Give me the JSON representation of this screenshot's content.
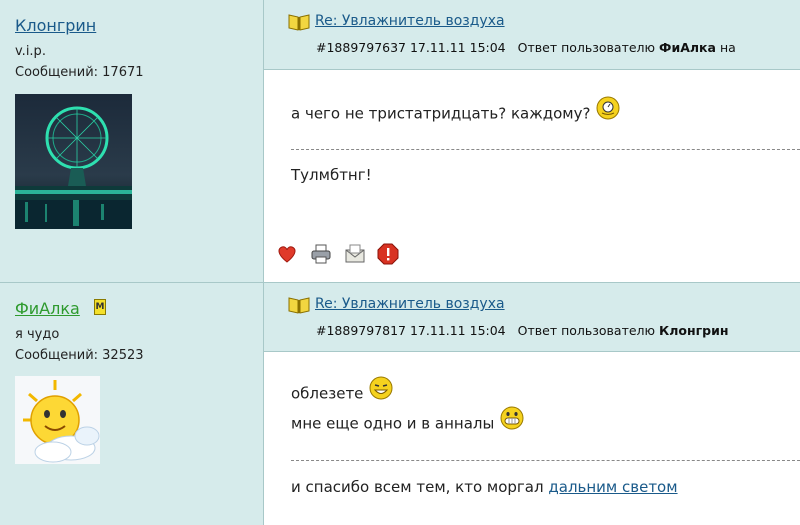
{
  "posts": [
    {
      "author": {
        "name": "Клонгрин",
        "status": "v.i.p.",
        "messages": "Сообщений: 17671",
        "avatar_icon": "ferris-wheel-night-photo"
      },
      "title": "Re: Увлажнитель воздуха",
      "meta": {
        "id_date": "#1889797637 17.11.11 15:04",
        "reply_to_prefix": "Ответ пользователю",
        "reply_to_user": "ФиАлка",
        "reply_to_suffix": "на"
      },
      "body_lines": [
        "а чего не тристатридцать? каждому?"
      ],
      "signature": "Тулмбтнг!",
      "actions": [
        "heart-icon",
        "print-icon",
        "mail-icon",
        "stop-icon"
      ]
    },
    {
      "author": {
        "name": "ФиАлка",
        "badge": "M",
        "status": "я чудо",
        "messages": "Сообщений: 32523",
        "avatar_icon": "sun-cloud-avatar"
      },
      "title": "Re: Увлажнитель воздуха",
      "meta": {
        "id_date": "#1889797817 17.11.11 15:04",
        "reply_to_prefix": "Ответ пользователю",
        "reply_to_user": "Клонгрин"
      },
      "body_lines": [
        "облезете",
        "мне еще одно и в анналы"
      ],
      "signature_prefix": "и спасибо всем тем, кто моргал",
      "signature_link": "дальним светом"
    }
  ],
  "colors": {
    "panel": "#d6ebeb",
    "link": "#1a5a8a",
    "moderator_name": "#2e9a2e"
  }
}
